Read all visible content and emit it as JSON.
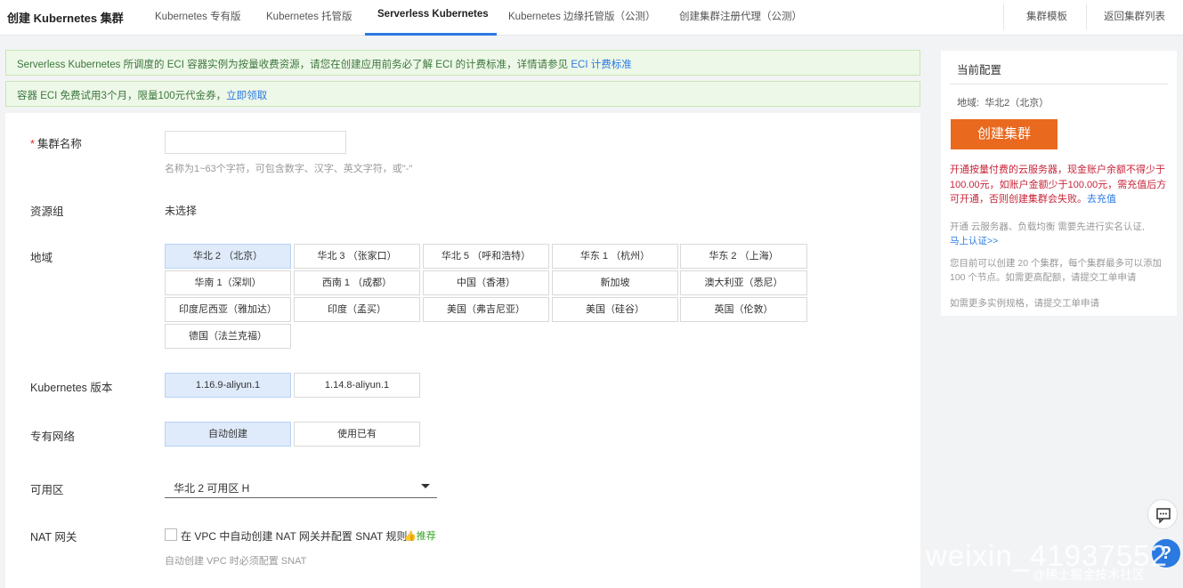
{
  "nav": {
    "title": "创建 Kubernetes 集群",
    "tabs": [
      "Kubernetes 专有版",
      "Kubernetes 托管版",
      "Serverless Kubernetes",
      "Kubernetes 边缘托管版（公测）",
      "创建集群注册代理（公测）"
    ],
    "right_links": [
      "集群模板",
      "返回集群列表"
    ]
  },
  "notices": {
    "eci_text": "Serverless Kubernetes 所调度的 ECI 容器实例为按量收费资源，请您在创建应用前务必了解 ECI 的计费标准，详情请参见 ",
    "eci_link": "ECI 计费标准",
    "trial_text": "容器 ECI 免费试用3个月，限量100元代金券，",
    "trial_link": "立即领取"
  },
  "form": {
    "cluster_name": {
      "required_mark": "*",
      "label": "集群名称",
      "value": "",
      "hint": "名称为1~63个字符，可包含数字、汉字、英文字符，或\"-\""
    },
    "resource_group": {
      "label": "资源组",
      "value": "未选择"
    },
    "region": {
      "label": "地域",
      "options": [
        "华北 2 （北京）",
        "华北 3 （张家口）",
        "华北 5 （呼和浩特）",
        "华东 1 （杭州）",
        "华东 2 （上海）",
        "华南 1（深圳）",
        "西南 1 （成都）",
        "中国（香港）",
        "新加坡",
        "澳大利亚（悉尼）",
        "印度尼西亚（雅加达）",
        "印度（孟买）",
        "美国（弗吉尼亚）",
        "美国（硅谷）",
        "英国（伦敦）",
        "德国（法兰克福）"
      ],
      "selected": "华北 2 （北京）"
    },
    "k8s_version": {
      "label": "Kubernetes 版本",
      "options": [
        "1.16.9-aliyun.1",
        "1.14.8-aliyun.1"
      ],
      "selected": "1.16.9-aliyun.1"
    },
    "vpc": {
      "label": "专有网络",
      "options": [
        "自动创建",
        "使用已有"
      ],
      "selected": "自动创建"
    },
    "zone": {
      "label": "可用区",
      "value": "华北 2 可用区 H"
    },
    "nat": {
      "label": "NAT 网关",
      "checkbox_label": "在 VPC 中自动创建 NAT 网关并配置 SNAT 规则",
      "checked": false,
      "recommend": "推荐",
      "hint": "自动创建 VPC 时必须配置 SNAT"
    }
  },
  "sidebar": {
    "title": "当前配置",
    "region_label": "地域:",
    "region_value": "华北2（北京）",
    "create_button": "创建集群",
    "warning_text": "开通按量付费的云服务器，现金账户余额不得少于100.00元，如账户金额少于100.00元，需充值后方可开通，否则创建集群会失败。",
    "warning_link": "去充值",
    "realname_text": "开通 云服务器、负载均衡 需要先进行实名认证,",
    "realname_link": "马上认证>>",
    "quota_text": "您目前可以创建 20 个集群，每个集群最多可以添加 100 个节点。如需更高配额，请提交工单申请",
    "more_text": "如需更多实例规格，请提交工单申请"
  },
  "watermark": {
    "csdn": "weixin_41937552",
    "juejin": "@稀土掘金技术社区"
  },
  "colors": {
    "accent": "#2a7ae2",
    "create_button": "#e9691e",
    "notice_bg": "#eef8e8",
    "warning": "#c7253a"
  }
}
